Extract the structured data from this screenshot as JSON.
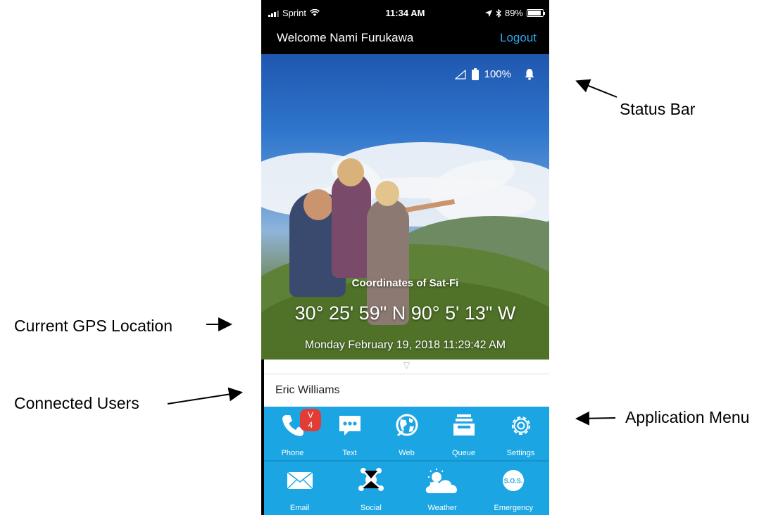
{
  "annotations": {
    "status_bar": "Status Bar",
    "gps_location": "Current GPS Location",
    "connected_users": "Connected Users",
    "app_menu": "Application Menu"
  },
  "ios_status": {
    "carrier": "Sprint",
    "time": "11:34 AM",
    "battery": "89%"
  },
  "header": {
    "welcome": "Welcome Nami Furukawa",
    "logout": "Logout"
  },
  "device_status": {
    "battery": "100%"
  },
  "location": {
    "title": "Coordinates of Sat-Fi",
    "coordinates": "30° 25' 59\" N  90° 5' 13\" W",
    "datetime": "Monday February 19, 2018 11:29:42 AM"
  },
  "users": {
    "toggle": "▽",
    "items": [
      "Eric Williams"
    ]
  },
  "menu": {
    "row1": [
      {
        "label": "Phone",
        "icon": "phone-icon",
        "badge": "V 4"
      },
      {
        "label": "Text",
        "icon": "chat-icon"
      },
      {
        "label": "Web",
        "icon": "globe-icon"
      },
      {
        "label": "Queue",
        "icon": "tray-icon"
      },
      {
        "label": "Settings",
        "icon": "gear-icon"
      }
    ],
    "row2": [
      {
        "label": "Email",
        "icon": "envelope-icon"
      },
      {
        "label": "Social",
        "icon": "network-icon"
      },
      {
        "label": "Weather",
        "icon": "cloud-sun-icon"
      },
      {
        "label": "Emergency",
        "icon": "sos-icon",
        "icon_text": "S.O.S."
      }
    ]
  },
  "colors": {
    "menu_bg": "#1ba6e3",
    "logout": "#2aa8e6",
    "badge": "#e23c35"
  }
}
